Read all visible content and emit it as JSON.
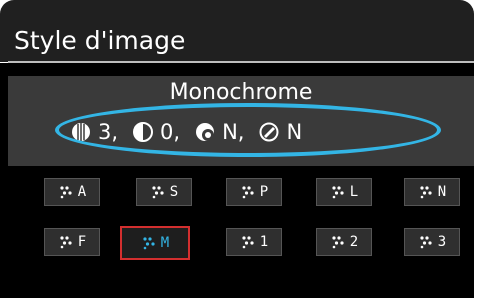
{
  "header": {
    "title": "Style d'image"
  },
  "current_style": {
    "name": "Monochrome",
    "params": [
      {
        "icon": "sharpness-icon",
        "value": "3,"
      },
      {
        "icon": "contrast-icon",
        "value": "0,"
      },
      {
        "icon": "filter-effect-icon",
        "value": "N,"
      },
      {
        "icon": "toning-effect-icon",
        "value": "N"
      }
    ]
  },
  "style_buttons": [
    {
      "label": "A",
      "selected": false
    },
    {
      "label": "S",
      "selected": false
    },
    {
      "label": "P",
      "selected": false
    },
    {
      "label": "L",
      "selected": false
    },
    {
      "label": "N",
      "selected": false
    },
    {
      "label": "F",
      "selected": false
    },
    {
      "label": "M",
      "selected": true
    },
    {
      "label": "1",
      "selected": false
    },
    {
      "label": "2",
      "selected": false
    },
    {
      "label": "3",
      "selected": false
    }
  ],
  "colors": {
    "highlight": "#33b5e5",
    "selection_border": "#d32f2f"
  }
}
